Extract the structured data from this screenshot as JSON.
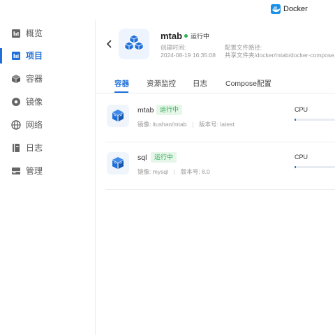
{
  "app": {
    "title": "Docker",
    "icon": "docker-whale-icon",
    "accent_color": "#1e6fd9"
  },
  "sidebar": {
    "items": [
      {
        "label": "概览",
        "icon": "overview-icon",
        "active": false
      },
      {
        "label": "项目",
        "icon": "project-icon",
        "active": true
      },
      {
        "label": "容器",
        "icon": "container-cube-icon",
        "active": false
      },
      {
        "label": "镜像",
        "icon": "image-disc-icon",
        "active": false
      },
      {
        "label": "网络",
        "icon": "globe-icon",
        "active": false
      },
      {
        "label": "日志",
        "icon": "log-book-icon",
        "active": false
      },
      {
        "label": "管理",
        "icon": "manage-icon",
        "active": false
      }
    ]
  },
  "project": {
    "name": "mtab",
    "status": "运行中",
    "status_color": "#2bb24c",
    "created_label": "创建时间:",
    "created_value": "2024-08-19 16:35:08",
    "config_label": "配置文件路径:",
    "config_value": "共享文件夹/docker/mtab/docker-compose.y"
  },
  "tabs": [
    {
      "label": "容器",
      "active": true
    },
    {
      "label": "资源监控",
      "active": false
    },
    {
      "label": "日志",
      "active": false
    },
    {
      "label": "Compose配置",
      "active": false
    }
  ],
  "containers": [
    {
      "name": "mtab",
      "status": "运行中",
      "image_label": "镜像:",
      "image": "itushan/mtab",
      "version_label": "版本号:",
      "version": "latest",
      "cpu_label": "CPU",
      "cpu_fraction": 0.03
    },
    {
      "name": "sql",
      "status": "运行中",
      "image_label": "镜像:",
      "image": "mysql",
      "version_label": "版本号:",
      "version": "8.0",
      "cpu_label": "CPU",
      "cpu_fraction": 0.03
    }
  ]
}
